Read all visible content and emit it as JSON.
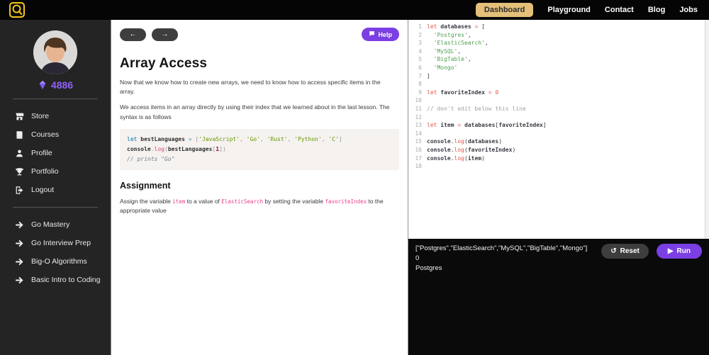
{
  "colors": {
    "accent_purple": "#7b3fe4",
    "brand_gold": "#e4c07a",
    "gem_purple": "#9061f9",
    "inline_code_pink": "#e83e8c"
  },
  "topbar": {
    "nav": [
      {
        "label": "Dashboard",
        "active": true
      },
      {
        "label": "Playground",
        "active": false
      },
      {
        "label": "Contact",
        "active": false
      },
      {
        "label": "Blog",
        "active": false
      },
      {
        "label": "Jobs",
        "active": false
      }
    ]
  },
  "sidebar": {
    "gems": "4886",
    "menu": [
      {
        "label": "Store",
        "icon": "store"
      },
      {
        "label": "Courses",
        "icon": "courses"
      },
      {
        "label": "Profile",
        "icon": "profile"
      },
      {
        "label": "Portfolio",
        "icon": "portfolio"
      },
      {
        "label": "Logout",
        "icon": "logout"
      }
    ],
    "courses": [
      {
        "label": "Go Mastery",
        "icon": "arrow"
      },
      {
        "label": "Go Interview Prep",
        "icon": "arrow"
      },
      {
        "label": "Big-O Algorithms",
        "icon": "arrow"
      },
      {
        "label": "Basic Intro to Coding",
        "icon": "arrow"
      }
    ]
  },
  "lesson": {
    "help_label": "Help",
    "title": "Array Access",
    "paragraph1": "Now that we know how to create new arrays, we need to know how to access specific items in the array.",
    "paragraph2": "We access items in an array directly by using their index that we learned about in the last lesson. The syntax is as follows",
    "example_code": [
      [
        [
          "kw",
          "let"
        ],
        [
          "pl",
          " "
        ],
        [
          "id",
          "bestLanguages"
        ],
        [
          "pl",
          " "
        ],
        [
          "op",
          "="
        ],
        [
          "pl",
          " "
        ],
        [
          "pu",
          "["
        ],
        [
          "st",
          "'JavaScript'"
        ],
        [
          "pu",
          ","
        ],
        [
          "pl",
          " "
        ],
        [
          "st",
          "'Go'"
        ],
        [
          "pu",
          ","
        ],
        [
          "pl",
          " "
        ],
        [
          "st",
          "'Rust'"
        ],
        [
          "pu",
          ","
        ],
        [
          "pl",
          " "
        ],
        [
          "st",
          "'Python'"
        ],
        [
          "pu",
          ","
        ],
        [
          "pl",
          " "
        ],
        [
          "st",
          "'C'"
        ],
        [
          "pu",
          "]"
        ]
      ],
      [
        [
          "id",
          "console"
        ],
        [
          "pu",
          "."
        ],
        [
          "fn",
          "log"
        ],
        [
          "pu",
          "("
        ],
        [
          "id",
          "bestLanguages"
        ],
        [
          "pu",
          "["
        ],
        [
          "nu",
          "1"
        ],
        [
          "pu",
          "]"
        ],
        [
          "pu",
          ")"
        ]
      ],
      [
        [
          "co",
          "// prints \"Go\""
        ]
      ]
    ],
    "assignment_title": "Assignment",
    "assignment": [
      {
        "t": "text",
        "v": "Assign the variable "
      },
      {
        "t": "code",
        "v": "item"
      },
      {
        "t": "text",
        "v": " to a value of "
      },
      {
        "t": "code",
        "v": "ElasticSearch"
      },
      {
        "t": "text",
        "v": " by setting the variable "
      },
      {
        "t": "code",
        "v": "favoriteIndex"
      },
      {
        "t": "text",
        "v": " to the appropriate value"
      }
    ]
  },
  "editor": {
    "lines": [
      [
        [
          "kw",
          "let"
        ],
        [
          "pl",
          " "
        ],
        [
          "id",
          "databases"
        ],
        [
          "pl",
          " "
        ],
        [
          "op",
          "="
        ],
        [
          "pl",
          " "
        ],
        [
          "pu",
          "["
        ]
      ],
      [
        [
          "pl",
          "  "
        ],
        [
          "st",
          "'Postgres'"
        ],
        [
          "pu",
          ","
        ]
      ],
      [
        [
          "pl",
          "  "
        ],
        [
          "st",
          "'ElasticSearch'"
        ],
        [
          "pu",
          ","
        ]
      ],
      [
        [
          "pl",
          "  "
        ],
        [
          "st",
          "'MySQL'"
        ],
        [
          "pu",
          ","
        ]
      ],
      [
        [
          "pl",
          "  "
        ],
        [
          "st",
          "'BigTable'"
        ],
        [
          "pu",
          ","
        ]
      ],
      [
        [
          "pl",
          "  "
        ],
        [
          "st",
          "'Mongo'"
        ]
      ],
      [
        [
          "pu",
          "]"
        ]
      ],
      [],
      [
        [
          "kw",
          "let"
        ],
        [
          "pl",
          " "
        ],
        [
          "id",
          "favoriteIndex"
        ],
        [
          "pl",
          " "
        ],
        [
          "op",
          "="
        ],
        [
          "pl",
          " "
        ],
        [
          "nu",
          "0"
        ]
      ],
      [],
      [
        [
          "co",
          "// don't edit below this line"
        ]
      ],
      [],
      [
        [
          "kw",
          "let"
        ],
        [
          "pl",
          " "
        ],
        [
          "id",
          "item"
        ],
        [
          "pl",
          " "
        ],
        [
          "op",
          "="
        ],
        [
          "pl",
          " "
        ],
        [
          "id",
          "databases"
        ],
        [
          "pu",
          "["
        ],
        [
          "id",
          "favoriteIndex"
        ],
        [
          "pu",
          "]"
        ]
      ],
      [],
      [
        [
          "id",
          "console"
        ],
        [
          "pu",
          "."
        ],
        [
          "fn",
          "log"
        ],
        [
          "pu",
          "("
        ],
        [
          "id",
          "databases"
        ],
        [
          "pu",
          ")"
        ]
      ],
      [
        [
          "id",
          "console"
        ],
        [
          "pu",
          "."
        ],
        [
          "fn",
          "log"
        ],
        [
          "pu",
          "("
        ],
        [
          "id",
          "favoriteIndex"
        ],
        [
          "pu",
          ")"
        ]
      ],
      [
        [
          "id",
          "console"
        ],
        [
          "pu",
          "."
        ],
        [
          "fn",
          "log"
        ],
        [
          "pu",
          "("
        ],
        [
          "id",
          "item"
        ],
        [
          "pu",
          ")"
        ]
      ],
      []
    ]
  },
  "console": {
    "outputs": [
      "[\"Postgres\",\"ElasticSearch\",\"MySQL\",\"BigTable\",\"Mongo\"]",
      "0",
      "Postgres"
    ],
    "reset_label": "Reset",
    "run_label": "Run"
  }
}
